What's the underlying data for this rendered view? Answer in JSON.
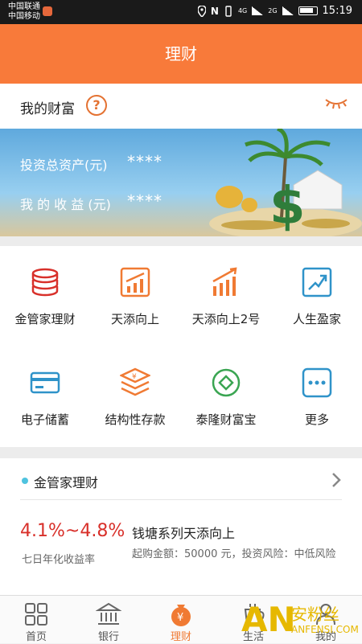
{
  "status_bar": {
    "carrier_1": "中国联通",
    "carrier_2": "中国移动",
    "time": "15:19",
    "network_1": "4G",
    "network_2": "2G"
  },
  "title_bar": {
    "title": "理财"
  },
  "wealth": {
    "title": "我的财富",
    "help_icon": "question-circle-icon",
    "eye_icon": "eye-closed-icon"
  },
  "banner": {
    "total_assets_label": "投资总资产(元)",
    "total_assets_value": "****",
    "income_label": "我 的 收 益 (元)",
    "income_value": "****"
  },
  "grid": {
    "items": [
      {
        "label": "金管家理财",
        "icon": "coins-stack-icon"
      },
      {
        "label": "天添向上",
        "icon": "trend-chart-icon"
      },
      {
        "label": "天添向上2号",
        "icon": "bar-chart-icon"
      },
      {
        "label": "人生盈家",
        "icon": "growth-arrow-icon"
      },
      {
        "label": "电子储蓄",
        "icon": "card-icon"
      },
      {
        "label": "结构性存款",
        "icon": "layers-yen-icon"
      },
      {
        "label": "泰隆财富宝",
        "icon": "diamond-circle-icon"
      },
      {
        "label": "更多",
        "icon": "more-dots-icon"
      }
    ]
  },
  "section": {
    "title": "金管家理财",
    "rate": "4.1%~4.8%",
    "rate_caption": "七日年化收益率",
    "product_name": "钱塘系列天添向上",
    "product_desc": "起购金额：50000 元，投资风险：中低风险"
  },
  "tab_bar": {
    "tabs": [
      {
        "label": "首页",
        "icon": "home-grid-icon"
      },
      {
        "label": "银行",
        "icon": "bank-icon"
      },
      {
        "label": "理财",
        "icon": "money-bag-icon",
        "active": true
      },
      {
        "label": "生活",
        "icon": "cup-icon"
      },
      {
        "label": "我的",
        "icon": "person-icon"
      }
    ]
  },
  "watermark": {
    "logo": "AN",
    "name": "安粉丝",
    "url": "ANFENSI.COM"
  },
  "colors": {
    "brand": "#f87a3a",
    "rate": "#d8302a",
    "icon_red": "#d8302a",
    "icon_orange": "#f07a33",
    "icon_green": "#3aa552",
    "icon_blue": "#2f93c9"
  }
}
